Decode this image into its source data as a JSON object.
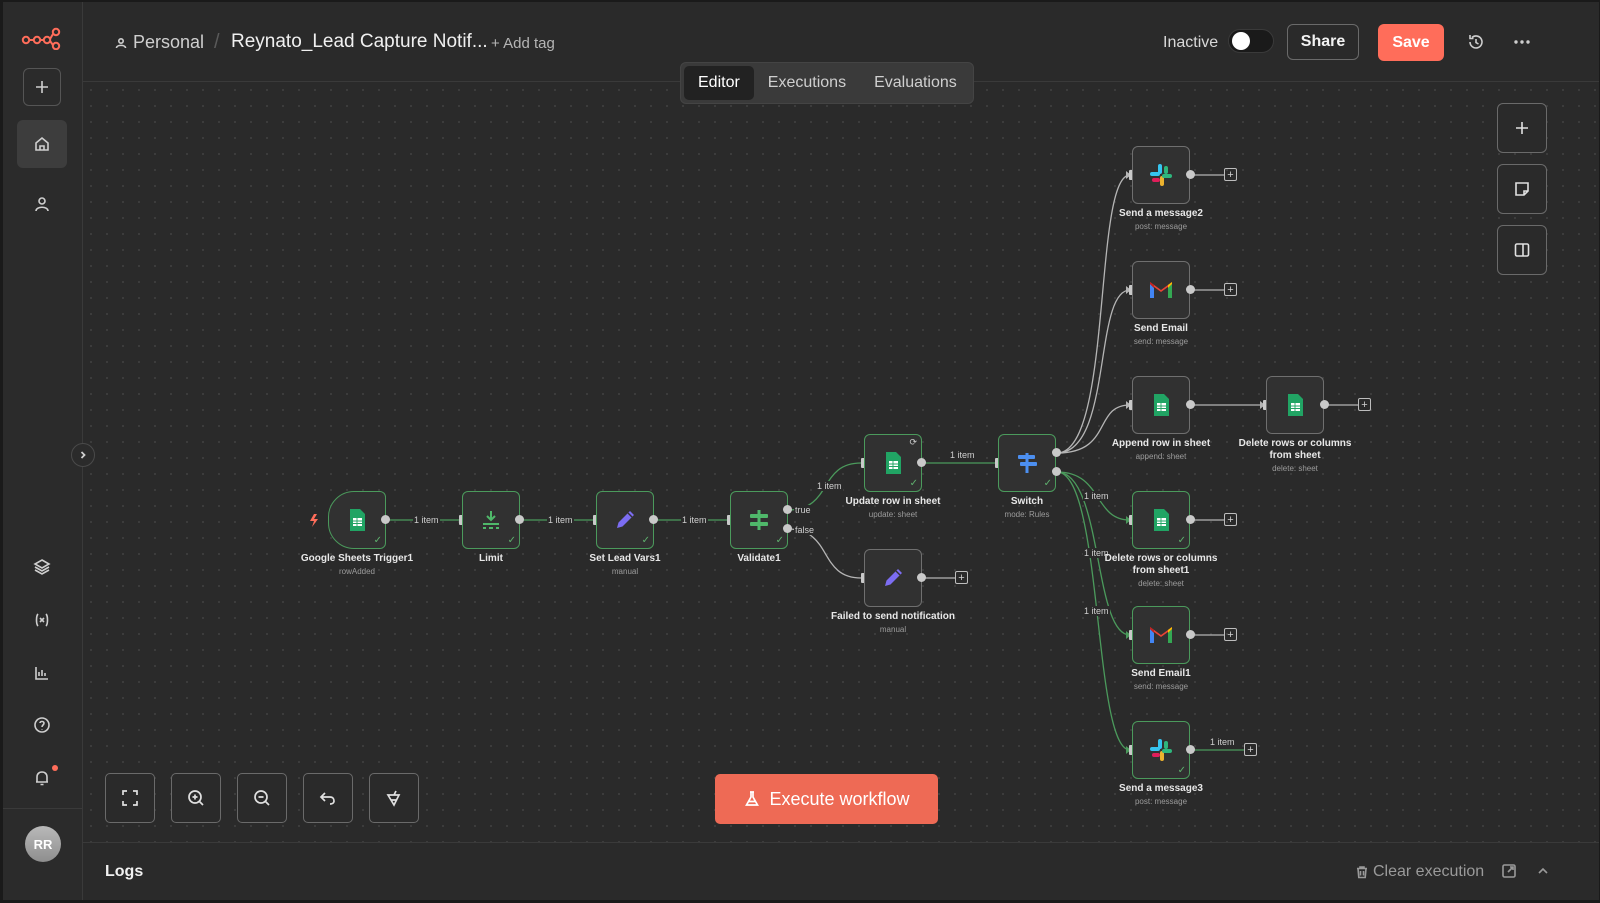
{
  "sidebar": {
    "logo": "n8n-logo",
    "items": [
      {
        "icon": "plus-icon"
      },
      {
        "icon": "home-icon"
      },
      {
        "icon": "user-icon"
      },
      {
        "icon": "templates-icon"
      },
      {
        "icon": "variables-icon"
      },
      {
        "icon": "insights-icon"
      },
      {
        "icon": "help-icon"
      },
      {
        "icon": "bell-icon"
      }
    ],
    "avatar_initials": "RR"
  },
  "header": {
    "project": "Personal",
    "separator": "/",
    "workflow_name": "Reynato_Lead Capture Notif...",
    "add_tag": "+ Add tag",
    "status_label": "Inactive",
    "active": false,
    "share_label": "Share",
    "save_label": "Save"
  },
  "tabs": [
    {
      "label": "Editor",
      "active": true
    },
    {
      "label": "Executions",
      "active": false
    },
    {
      "label": "Evaluations",
      "active": false
    }
  ],
  "workflow": {
    "nodes": [
      {
        "id": "trigger",
        "name": "Google Sheets Trigger1",
        "subtitle": "rowAdded",
        "icon": "google-sheets-icon",
        "executed": true
      },
      {
        "id": "limit",
        "name": "Limit",
        "subtitle": "",
        "icon": "limit-icon",
        "executed": true
      },
      {
        "id": "setvars",
        "name": "Set Lead Vars1",
        "subtitle": "manual",
        "icon": "pencil-icon",
        "executed": true
      },
      {
        "id": "validate",
        "name": "Validate1",
        "subtitle": "",
        "icon": "if-icon",
        "executed": true
      },
      {
        "id": "update",
        "name": "Update row in sheet",
        "subtitle": "update: sheet",
        "icon": "google-sheets-icon",
        "executed": true
      },
      {
        "id": "failed",
        "name": "Failed to send notification",
        "subtitle": "manual",
        "icon": "pencil-icon",
        "executed": false
      },
      {
        "id": "switch",
        "name": "Switch",
        "subtitle": "mode: Rules",
        "icon": "switch-icon",
        "executed": true
      },
      {
        "id": "slack2",
        "name": "Send a message2",
        "subtitle": "post: message",
        "icon": "slack-icon",
        "executed": false
      },
      {
        "id": "email",
        "name": "Send Email",
        "subtitle": "send: message",
        "icon": "gmail-icon",
        "executed": false
      },
      {
        "id": "append",
        "name": "Append row in sheet",
        "subtitle": "append: sheet",
        "icon": "google-sheets-icon",
        "executed": false
      },
      {
        "id": "delete",
        "name": "Delete rows or columns from sheet",
        "subtitle": "delete: sheet",
        "icon": "google-sheets-icon",
        "executed": false
      },
      {
        "id": "delete1",
        "name": "Delete rows or columns from sheet1",
        "subtitle": "delete: sheet",
        "icon": "google-sheets-icon",
        "executed": true
      },
      {
        "id": "email1",
        "name": "Send Email1",
        "subtitle": "send: message",
        "icon": "gmail-icon",
        "executed": true
      },
      {
        "id": "slack3",
        "name": "Send a message3",
        "subtitle": "post: message",
        "icon": "slack-icon",
        "executed": true
      }
    ],
    "edge_labels": {
      "item": "1 item",
      "true": "true",
      "false": "false"
    }
  },
  "canvas_controls": [
    "fit-view-icon",
    "zoom-in-icon",
    "zoom-out-icon",
    "undo-icon",
    "tidy-up-icon"
  ],
  "right_controls": [
    "add-node-icon",
    "sticky-note-icon",
    "panel-icon"
  ],
  "execute_label": "Execute workflow",
  "logs": {
    "title": "Logs",
    "clear_label": "Clear execution"
  },
  "colors": {
    "accent": "#ff6d5a",
    "success": "#4b9a5c",
    "canvas": "#2a2a2a"
  }
}
